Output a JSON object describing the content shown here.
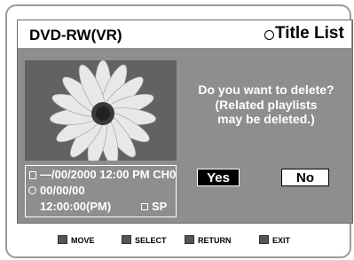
{
  "header": {
    "device": "DVD-RW(VR)",
    "menu_title": "Title List",
    "disc_icon": "disc-icon"
  },
  "title_info": {
    "date_channel": "—/00/2000 12:00 PM CH0",
    "length_date": "00/00/00",
    "length_time": "12:00:00(PM)",
    "record_mode": "SP"
  },
  "dialog": {
    "question": "Do you want to delete?",
    "note_line1": "(Related playlists",
    "note_line2": "may be deleted.)",
    "yes_label": "Yes",
    "no_label": "No"
  },
  "footer": {
    "move": "MOVE",
    "select": "SELECT",
    "return": "RETURN",
    "exit": "EXIT"
  }
}
